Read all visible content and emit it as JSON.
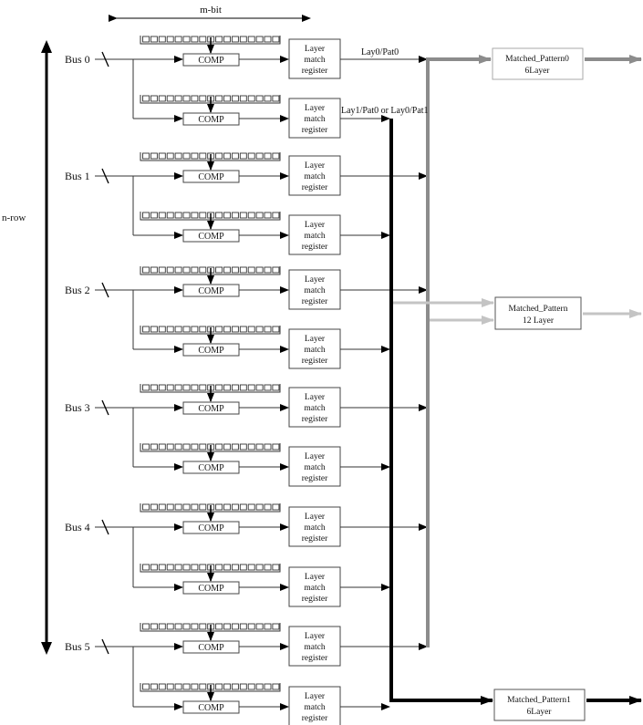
{
  "diagram": {
    "dimension_labels": {
      "width": "m-bit",
      "height": "n-row"
    },
    "buses": [
      {
        "label": "Bus 0"
      },
      {
        "label": "Bus 1"
      },
      {
        "label": "Bus 2"
      },
      {
        "label": "Bus 3"
      },
      {
        "label": "Bus 4"
      },
      {
        "label": "Bus 5"
      }
    ],
    "rows_per_bus": 2,
    "bits_per_pattern_row": 17,
    "comparator_label": "COMP",
    "register_label_lines": [
      "Layer",
      "match",
      "register"
    ],
    "signal_labels": {
      "upper_output": "Lay0/Pat0",
      "lower_output": "Lay1/Pat0 or Lay0/Pat1"
    },
    "outputs": [
      {
        "id": "matched-pattern-0",
        "lines": [
          "Matched_Pattern0",
          "6Layer"
        ],
        "bus_color": "#8c8c8c",
        "source": "upper registers"
      },
      {
        "id": "matched-pattern-12",
        "lines": [
          "Matched_Pattern",
          "12 Layer"
        ],
        "bus_color": "#c4c4c4",
        "source": "both buses"
      },
      {
        "id": "matched-pattern-1",
        "lines": [
          "Matched_Pattern1",
          "6Layer"
        ],
        "bus_color": "#000000",
        "source": "lower registers"
      }
    ],
    "colors": {
      "line": "#333333",
      "box_border": "#555555",
      "gray_bus": "#8c8c8c",
      "light_bus": "#c4c4c4",
      "black_bus": "#000000"
    }
  }
}
